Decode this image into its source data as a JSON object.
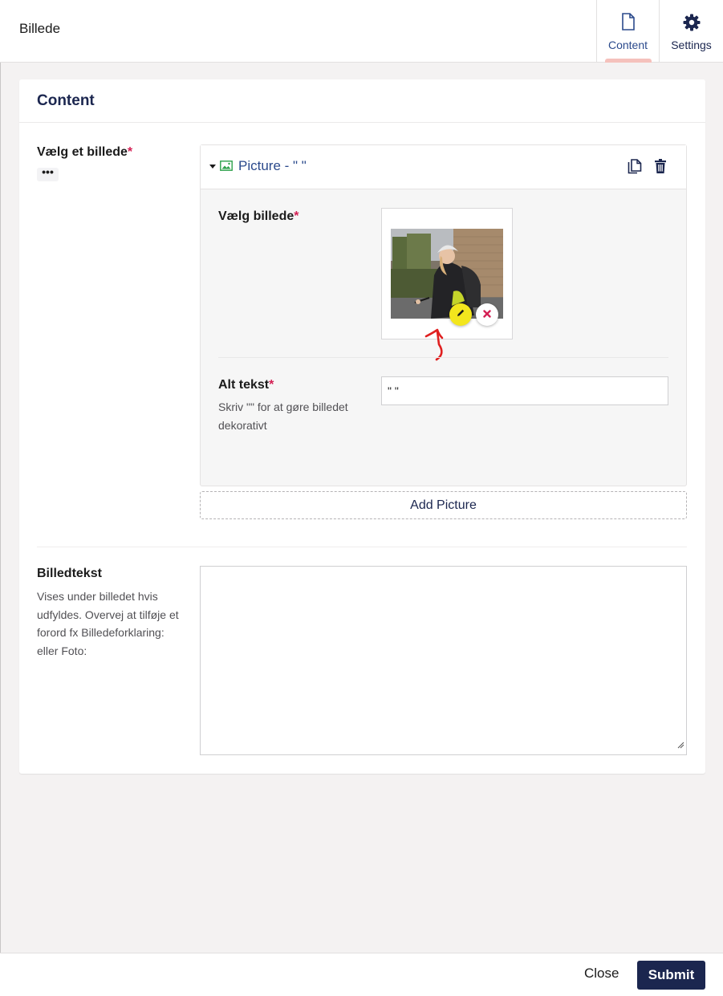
{
  "header": {
    "title": "Billede",
    "tabs": [
      {
        "label": "Content",
        "icon": "document-icon",
        "active": true
      },
      {
        "label": "Settings",
        "icon": "gear-icon",
        "active": false
      }
    ]
  },
  "card": {
    "title": "Content",
    "choose_image": {
      "label": "Vælg et billede",
      "required_mark": "*",
      "actions_label": "•••"
    },
    "block": {
      "title": "Picture - \" \"",
      "picker": {
        "label": "Vælg billede",
        "required_mark": "*"
      },
      "alt_text": {
        "label": "Alt tekst",
        "required_mark": "*",
        "description": "Skriv \"\" for at gøre billedet dekorativt",
        "value": "\" \""
      }
    },
    "add_button": "Add Picture",
    "caption": {
      "label": "Billedtekst",
      "description": "Vises under billedet hvis udfyldes. Overvej at tilføje et forord fx Billedeforklaring: eller Foto:",
      "value": ""
    }
  },
  "footer": {
    "close_label": "Close",
    "submit_label": "Submit"
  },
  "colors": {
    "primary": "#1b264f",
    "accent_blue": "#2b4a8c",
    "required": "#d42054",
    "edit_button": "#f3e61d",
    "tab_indicator": "#f5c1bc",
    "annotation_arrow": "#e02020"
  }
}
